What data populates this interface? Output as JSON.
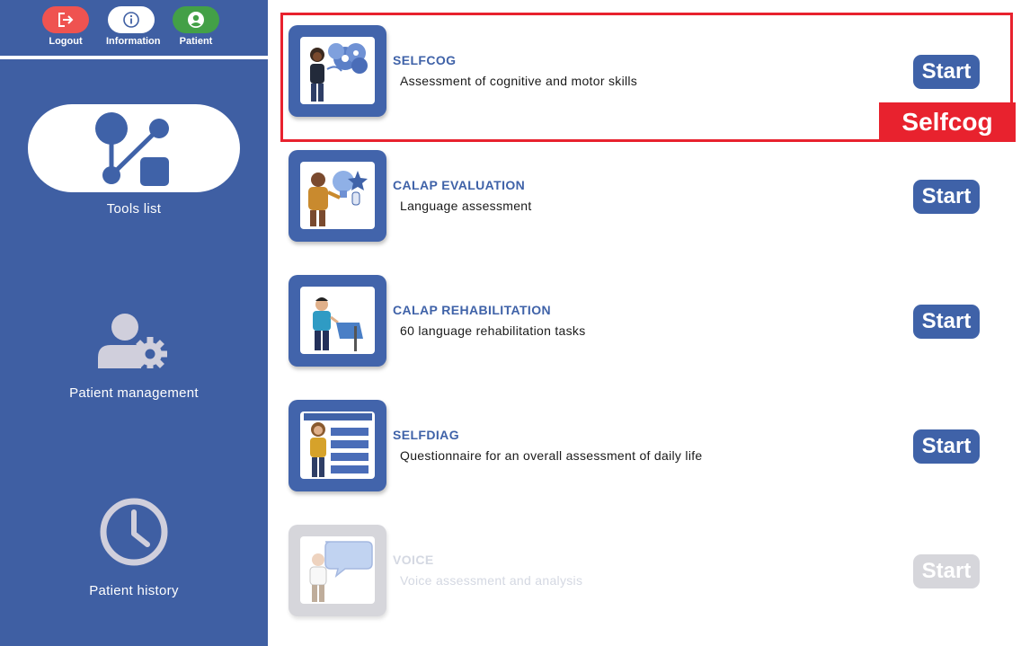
{
  "top_actions": {
    "logout": "Logout",
    "information": "Information",
    "patient": "Patient"
  },
  "nav": {
    "tools_list": "Tools list",
    "patient_management": "Patient management",
    "patient_history": "Patient history"
  },
  "tools": [
    {
      "name": "SELFCOG",
      "description": "Assessment of cognitive and motor skills",
      "button": "Start",
      "enabled": true
    },
    {
      "name": "CALAP EVALUATION",
      "description": "Language assessment",
      "button": "Start",
      "enabled": true
    },
    {
      "name": "CALAP REHABILITATION",
      "description": "60 language rehabilitation tasks",
      "button": "Start",
      "enabled": true
    },
    {
      "name": "SELFDIAG",
      "description": "Questionnaire for an overall assessment of daily life",
      "button": "Start",
      "enabled": true
    },
    {
      "name": "VOICE",
      "description": "Voice assessment and analysis",
      "button": "Start",
      "enabled": false
    }
  ],
  "highlight": {
    "label": "Selfcog",
    "color": "#e8222e"
  },
  "colors": {
    "sidebar": "#3f5fa3",
    "accent": "#3f62a8",
    "logout": "#ef5350",
    "patient": "#43a047",
    "disabled": "#d6d6db"
  },
  "icons": [
    "logout-icon",
    "info-icon",
    "user-circle-icon",
    "tools-nodes-icon",
    "user-gear-icon",
    "clock-icon"
  ]
}
